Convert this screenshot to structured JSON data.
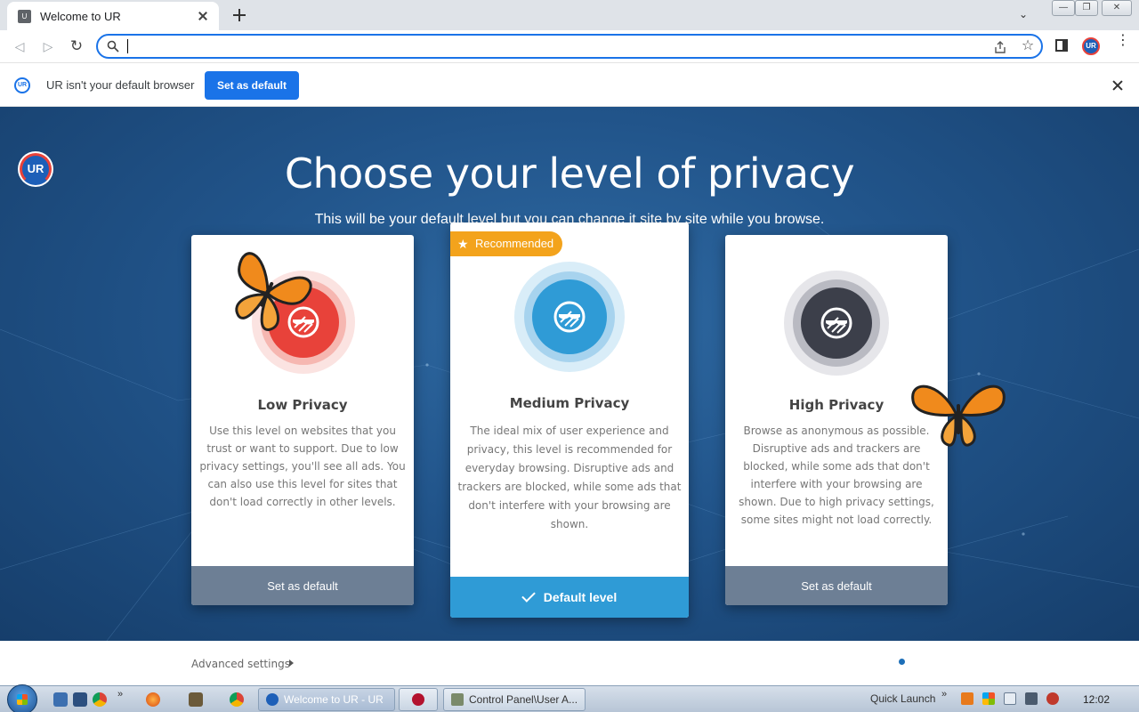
{
  "browser": {
    "tab": {
      "title": "Welcome to UR",
      "favicon_text": "U"
    },
    "omnibox": {
      "value": "",
      "placeholder": ""
    },
    "profile_initials": "UR"
  },
  "infobar": {
    "logo_text": "UR",
    "message": "UR isn't your default browser",
    "button_label": "Set as default"
  },
  "page": {
    "logo_text": "UR",
    "title": "Choose your level of privacy",
    "subtitle": "This will be your default level but you can change it site by site while you browse.",
    "recommended_label": "Recommended",
    "cards": [
      {
        "heading": "Low Privacy",
        "description": "Use this level on websites that you trust or want to support. Due to low privacy settings, you'll see all ads. You can also use this level for sites that don't load correctly in other levels.",
        "button_label": "Set as default",
        "color": "#e8423a"
      },
      {
        "heading": "Medium Privacy",
        "description": "The ideal mix of user experience and privacy, this level is recommended for everyday browsing. Disruptive ads and trackers are blocked, while some ads that don't interfere with your browsing are shown.",
        "button_label": "Default level",
        "color": "#2f9bd6"
      },
      {
        "heading": "High Privacy",
        "description": "Browse as anonymous as possible. Disruptive ads and trackers are blocked, while some ads that don't interfere with your browsing are shown. Due to high privacy settings, some sites might not load correctly.",
        "button_label": "Set as default",
        "color": "#3c3f4a"
      }
    ],
    "advanced_settings": "Advanced settings"
  },
  "taskbar": {
    "tasks": [
      {
        "label": "Welcome to UR - UR"
      },
      {
        "label": "Control Panel\\User A..."
      }
    ],
    "quick_launch": "Quick Launch",
    "chevron": "»",
    "clock": "12:02"
  }
}
